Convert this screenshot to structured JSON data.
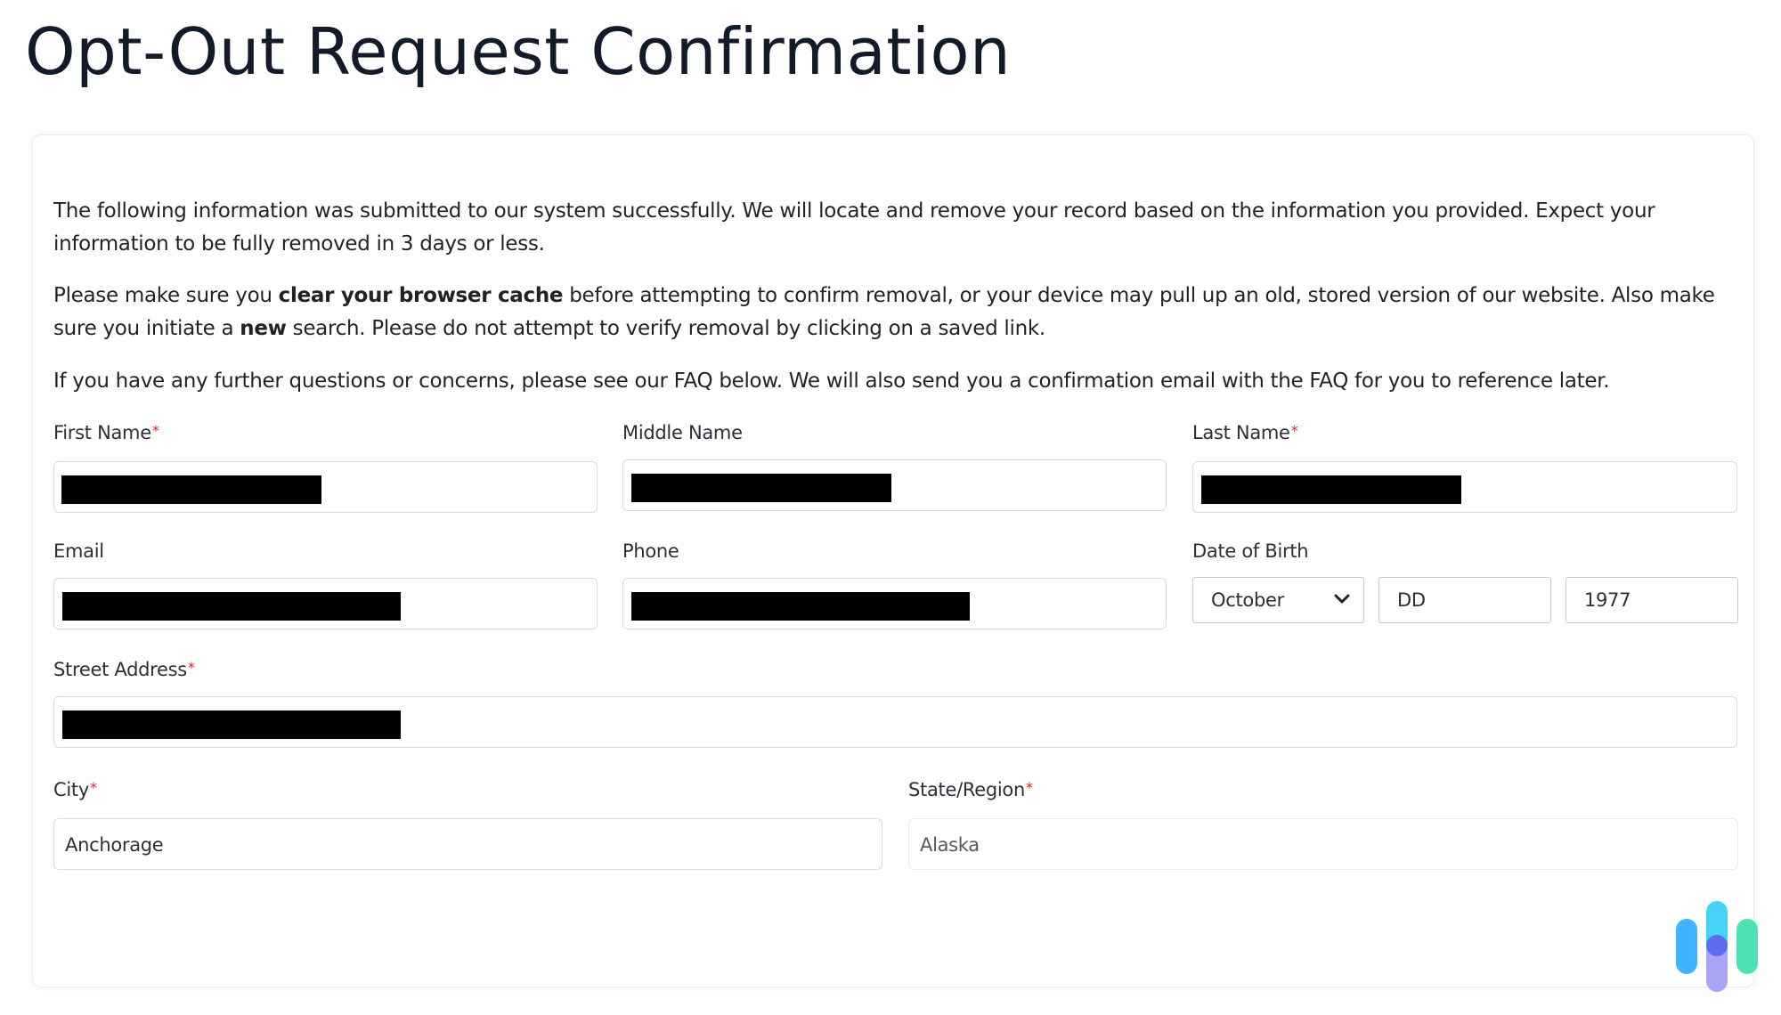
{
  "page": {
    "title": "Opt-Out Request Confirmation"
  },
  "intro": {
    "p1": "The following information was submitted to our system successfully. We will locate and remove your record based on the information you provided. Expect your information to be fully removed in 3 days or less.",
    "p2_before": "Please make sure you ",
    "p2_bold1": "clear your browser cache",
    "p2_mid": " before attempting to confirm removal, or your device may pull up an old, stored version of our website. Also make sure you initiate a ",
    "p2_bold2": "new",
    "p2_after": " search. Please do not attempt to verify removal by clicking on a saved link.",
    "p3": "If you have any further questions or concerns, please see our FAQ below. We will also send you a confirmation email with the FAQ for you to reference later."
  },
  "form": {
    "required_marker": "*",
    "first_name": {
      "label": "First Name",
      "required": true,
      "value": "[redacted]"
    },
    "middle_name": {
      "label": "Middle Name",
      "required": false,
      "value": "[redacted]"
    },
    "last_name": {
      "label": "Last Name",
      "required": true,
      "value": "[redacted]"
    },
    "email": {
      "label": "Email",
      "required": false,
      "value": "[redacted]"
    },
    "phone": {
      "label": "Phone",
      "required": false,
      "value": "[redacted]"
    },
    "dob": {
      "label": "Date of Birth",
      "month": "October",
      "day_placeholder": "DD",
      "year": "1977"
    },
    "street_address": {
      "label": "Street Address",
      "required": true,
      "value": "[redacted]"
    },
    "city": {
      "label": "City",
      "required": true,
      "value": "Anchorage"
    },
    "state": {
      "label": "State/Region",
      "required": true,
      "value": "Alaska"
    }
  },
  "colors": {
    "required": "#e0202a",
    "title": "#131a2a",
    "logo_blue": "#42b3ff",
    "logo_cyan": "#45d4f5",
    "logo_lavender": "#a9a4f6",
    "logo_indigo": "#5b6ef0",
    "logo_green": "#4be3b5"
  },
  "icons": {
    "dropdown": "chevron-down-icon",
    "brand": "brand-logo-icon"
  }
}
